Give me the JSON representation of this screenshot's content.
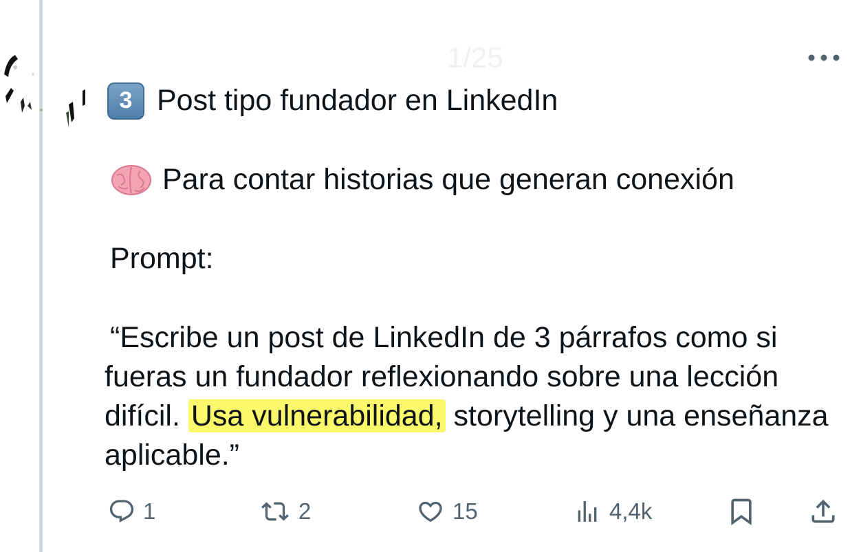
{
  "tweet": {
    "header_index": "1/25",
    "heading_number": "3",
    "heading_text": "Post tipo fundador en LinkedIn",
    "subtitle_text": "Para contar historias que generan conexión",
    "prompt_label": "Prompt:",
    "quote_part1": "“Escribe un post de LinkedIn de 3 párrafos como si fueras un fundador reflexionando sobre una lección difícil. ",
    "quote_highlight": "Usa vulnerabilidad,",
    "quote_part2": " storytelling y una enseñanza aplicable.”",
    "highlight_color": "#fbf96b"
  },
  "actions": {
    "replies": "1",
    "retweets": "2",
    "likes": "15",
    "views": "4,4k"
  },
  "icons": {
    "more": "more-horizontal-icon",
    "reply": "reply-icon",
    "retweet": "retweet-icon",
    "like": "heart-icon",
    "views": "views-chart-icon",
    "bookmark": "bookmark-icon",
    "share": "share-icon",
    "heading_emoji": "keycap-3-emoji",
    "subtitle_emoji": "brain-emoji"
  },
  "colors": {
    "text": "#0f1419",
    "muted": "#536471",
    "thread_line": "#cfd9de"
  }
}
